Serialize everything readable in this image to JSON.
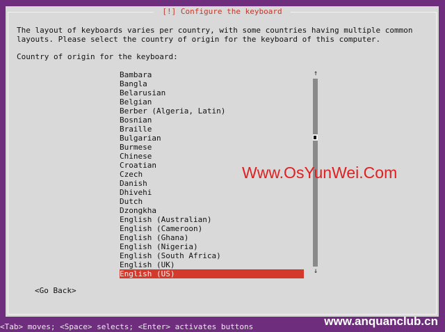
{
  "dialog": {
    "title": "[!] Configure the keyboard",
    "description": "The layout of keyboards varies per country, with some countries having multiple common\nlayouts. Please select the country of origin for the keyboard of this computer.",
    "prompt": "Country of origin for the keyboard:",
    "countries": [
      "Bambara",
      "Bangla",
      "Belarusian",
      "Belgian",
      "Berber (Algeria, Latin)",
      "Bosnian",
      "Braille",
      "Bulgarian",
      "Burmese",
      "Chinese",
      "Croatian",
      "Czech",
      "Danish",
      "Dhivehi",
      "Dutch",
      "Dzongkha",
      "English (Australian)",
      "English (Cameroon)",
      "English (Ghana)",
      "English (Nigeria)",
      "English (South Africa)",
      "English (UK)",
      "English (US)"
    ],
    "selected_country": "English (US)",
    "go_back_label": "<Go Back>",
    "scroll_up_arrow": "↑",
    "scroll_down_arrow": "↓"
  },
  "status_bar": {
    "help_text": "<Tab> moves; <Space> selects; <Enter> activates buttons"
  },
  "watermarks": {
    "center": "Www.OsYunWei.Com",
    "bottom_right": "www.anquanclub.cn"
  },
  "colors": {
    "background": "#6f2d7d",
    "dialog": "#d9d9d9",
    "title_text": "#c0392b",
    "selection": "#d33a2c",
    "watermark": "#e02020"
  }
}
